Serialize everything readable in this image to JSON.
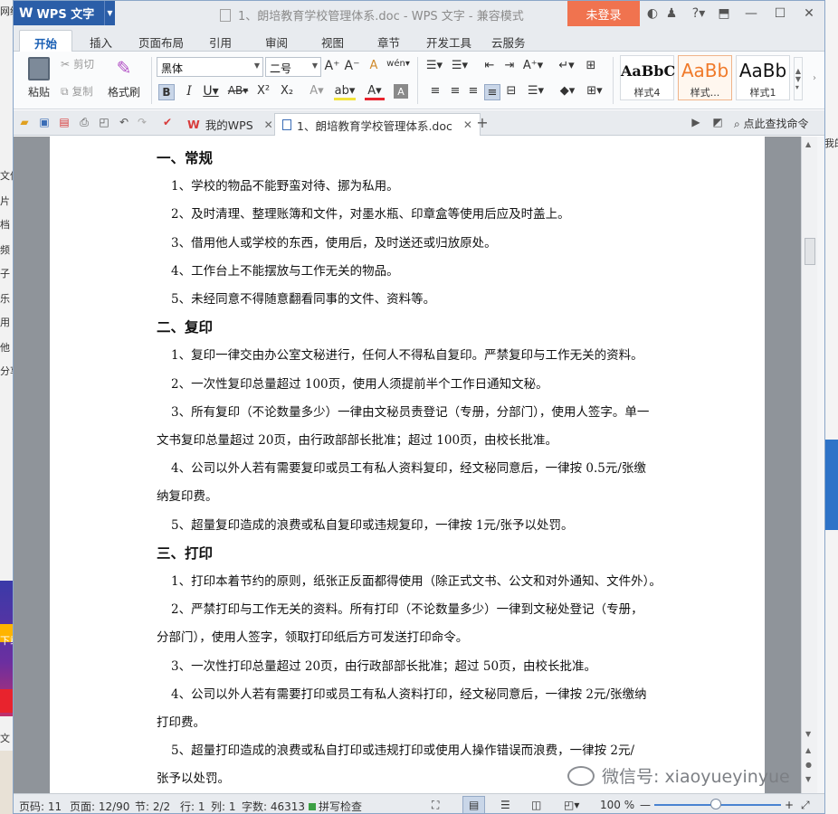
{
  "background_left": {
    "items": [
      "网络",
      "文件",
      "片",
      "档",
      "频",
      "子",
      "乐",
      "用",
      "他",
      "分享",
      "下载",
      "文"
    ]
  },
  "background_right": {
    "text": "我的"
  },
  "app": {
    "name": "WPS 文字",
    "logo": "W"
  },
  "window": {
    "title": "1、朗培教育学校管理体系.doc - WPS 文字 - 兼容模式",
    "login_label": "未登录",
    "icons": [
      "shirt-icon",
      "help-icon",
      "restore-icon",
      "minimize-icon",
      "maximize-icon",
      "close-icon"
    ]
  },
  "menu": {
    "tabs": [
      "开始",
      "插入",
      "页面布局",
      "引用",
      "审阅",
      "视图",
      "章节",
      "开发工具",
      "云服务"
    ]
  },
  "ribbon": {
    "paste": "粘贴",
    "cut": "剪切",
    "copy": "复制",
    "format_painter": "格式刷",
    "font_name": "黑体",
    "font_size": "二号",
    "styles": [
      {
        "preview": "AaBbC",
        "label": "样式4"
      },
      {
        "preview": "AaBb",
        "label": "样式..."
      },
      {
        "preview": "AaBb",
        "label": "样式1"
      }
    ],
    "accent_color": "#f07a2a"
  },
  "tabs_bar": {
    "doc_tabs": [
      "我的WPS",
      "1、朗培教育学校管理体系.doc"
    ],
    "search_label": "点此查找命令"
  },
  "document": {
    "lines": [
      {
        "type": "h",
        "text": "一、常规"
      },
      {
        "type": "p",
        "text": "1、学校的物品不能野蛮对待、挪为私用。"
      },
      {
        "type": "p",
        "text": "2、及时清理、整理账簿和文件，对墨水瓶、印章盒等使用后应及时盖上。"
      },
      {
        "type": "p",
        "text": "3、借用他人或学校的东西，使用后，及时送还或归放原处。"
      },
      {
        "type": "p",
        "text": "4、工作台上不能摆放与工作无关的物品。"
      },
      {
        "type": "p",
        "text": "5、未经同意不得随意翻看同事的文件、资料等。"
      },
      {
        "type": "h",
        "text": "二、复印"
      },
      {
        "type": "p",
        "text": "1、复印一律交由办公室文秘进行，任何人不得私自复印。严禁复印与工作无关的资料。"
      },
      {
        "type": "p",
        "text": "2、一次性复印总量超过 100页，使用人须提前半个工作日通知文秘。"
      },
      {
        "type": "p",
        "text": "3、所有复印（不论数量多少）一律由文秘员责登记（专册，分部门），使用人签字。单一"
      },
      {
        "type": "c",
        "text": "文书复印总量超过 20页，由行政部部长批准；超过 100页，由校长批准。"
      },
      {
        "type": "p",
        "text": "4、公司以外人若有需要复印或员工有私人资料复印，经文秘同意后，一律按 0.5元/张缴"
      },
      {
        "type": "c",
        "text": "纳复印费。"
      },
      {
        "type": "p",
        "text": "5、超量复印造成的浪费或私自复印或违规复印，一律按 1元/张予以处罚。"
      },
      {
        "type": "h",
        "text": "三、打印"
      },
      {
        "type": "p",
        "text": "1、打印本着节约的原则，纸张正反面都得使用（除正式文书、公文和对外通知、文件外）。"
      },
      {
        "type": "p",
        "text": "2、严禁打印与工作无关的资料。所有打印（不论数量多少）一律到文秘处登记（专册，"
      },
      {
        "type": "c",
        "text": "分部门），使用人签字，领取打印纸后方可发送打印命令。"
      },
      {
        "type": "p",
        "text": "3、一次性打印总量超过 20页，由行政部部长批准；超过 50页，由校长批准。"
      },
      {
        "type": "p",
        "text": "4、公司以外人若有需要打印或员工有私人资料打印，经文秘同意后，一律按 2元/张缴纳"
      },
      {
        "type": "c",
        "text": "打印费。"
      },
      {
        "type": "p",
        "text": "5、超量打印造成的浪费或私自打印或违规打印或使用人操作错误而浪费，一律按 2元/"
      },
      {
        "type": "c",
        "text": "张予以处罚。"
      }
    ]
  },
  "status": {
    "page_code": "页码: 11",
    "page": "页面: 12/90",
    "section": "节: 2/2",
    "row": "行: 1",
    "col": "列: 1",
    "word_count": "字数: 46313",
    "spell": "拼写检查",
    "zoom": "100 %"
  },
  "watermark": {
    "text": "微信号: xiaoyueyinyue"
  }
}
